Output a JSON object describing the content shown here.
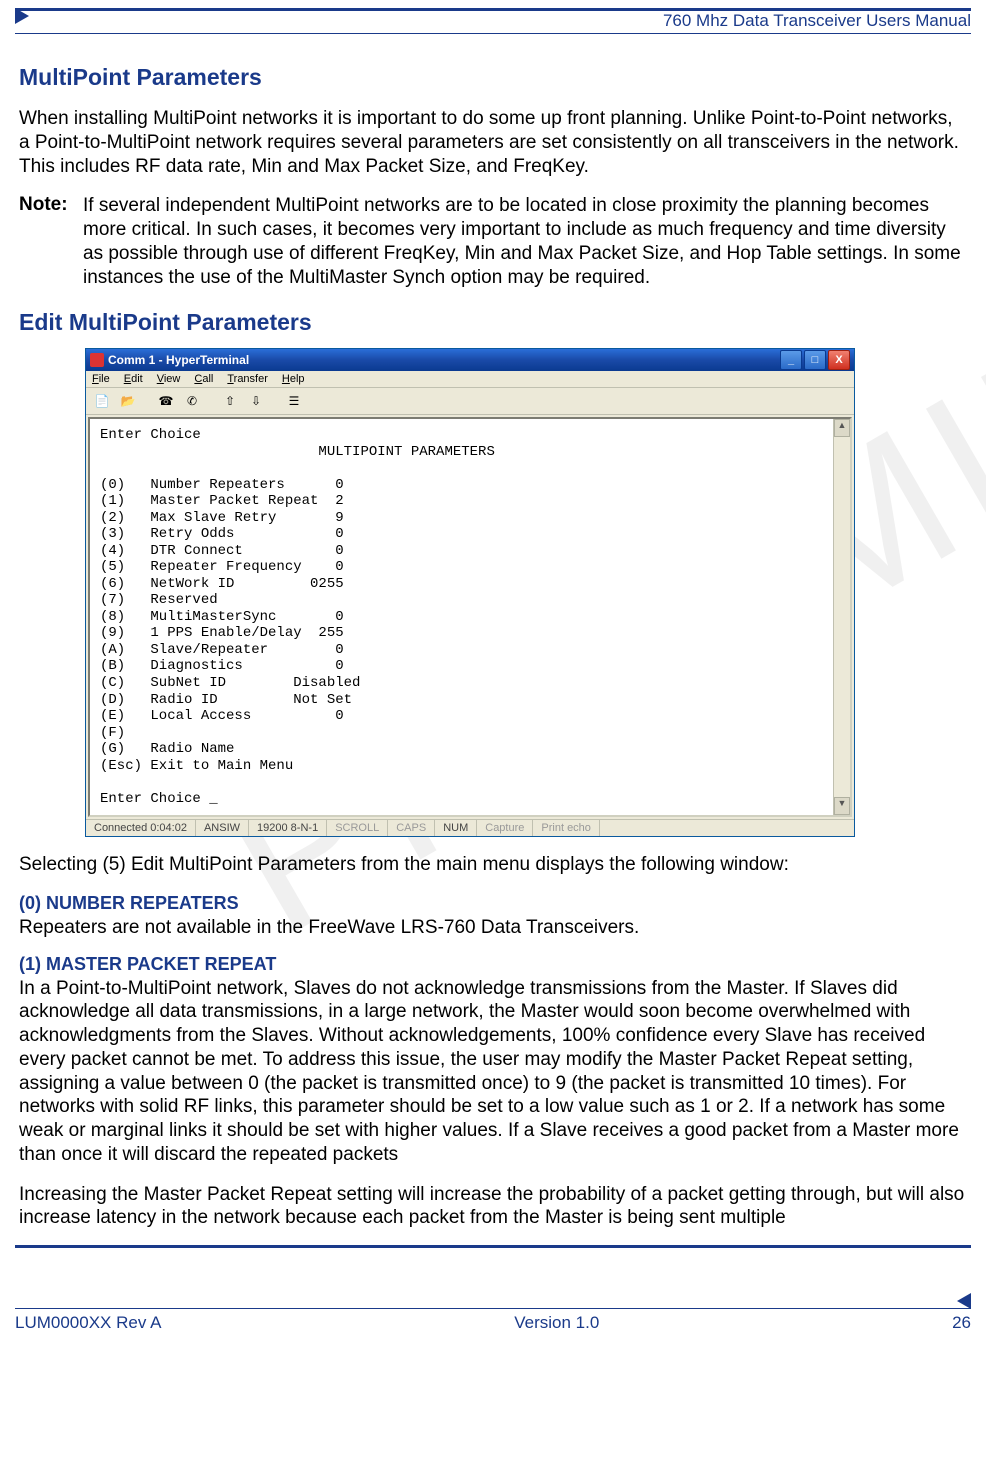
{
  "header": {
    "title": "760 Mhz Data Transceiver Users Manual"
  },
  "watermark": "PRELIMINARY",
  "sections": {
    "h1": "MultiPoint Parameters",
    "p1": "When installing MultiPoint networks it is important to do some up front planning. Unlike Point-to-Point networks, a Point-to-MultiPoint network requires several parameters are set consistently on all transceivers in the network. This includes RF data rate, Min and Max Packet Size, and FreqKey.",
    "note_label": "Note:",
    "note_body": "If several independent MultiPoint networks are to be located in close proximity the planning becomes more critical. In such cases, it becomes very important to include as much frequency and time diversity as possible through use of different FreqKey, Min and Max Packet Size, and Hop Table settings. In some instances the use of the MultiMaster Synch option may be required.",
    "h2": "Edit MultiPoint Parameters",
    "p2": "Selecting (5) Edit MultiPoint Parameters from the main menu displays the following window:",
    "param0_h": " (0) NUMBER REPEATERS",
    "param0_p": "Repeaters are not available in the FreeWave LRS-760 Data Transceivers.",
    "param1_h": "(1) MASTER PACKET REPEAT",
    "param1_p": "In a Point-to-MultiPoint network, Slaves do not acknowledge transmissions from the Master. If Slaves did acknowledge all data transmissions, in a large network, the Master would soon become overwhelmed with acknowledgments from the Slaves.  Without acknowledgements, 100% confidence every Slave has received every packet cannot be met. To address this issue, the user may modify the Master Packet Repeat setting, assigning a value between 0 (the packet is transmitted once) to 9 (the packet is transmitted 10 times). For networks with solid RF links, this parameter should be set to a low value such as 1 or 2. If a network has some weak or marginal links it should be set with higher values. If a Slave receives a good packet from a Master more than once it will discard the repeated packets",
    "param1_p2": "Increasing the Master Packet Repeat setting will increase the probability of a packet getting through, but will also increase latency in the network because each packet from the Master is being sent multiple"
  },
  "hyperterminal": {
    "title": "Comm 1 - HyperTerminal",
    "menu": [
      "File",
      "Edit",
      "View",
      "Call",
      "Transfer",
      "Help"
    ],
    "toolbar_icons": [
      "new-doc-icon",
      "open-icon",
      "sep",
      "call-icon",
      "hangup-icon",
      "sep",
      "send-icon",
      "receive-icon",
      "sep",
      "props-icon"
    ],
    "scroll_up": "▲",
    "scroll_down": "▼",
    "winbtns": {
      "min": "_",
      "max": "□",
      "close": "X"
    },
    "terminal": {
      "prompt1": "Enter Choice",
      "heading": "                          MULTIPOINT PARAMETERS",
      "blank": "",
      "lines": [
        "(0)   Number Repeaters      0",
        "(1)   Master Packet Repeat  2",
        "(2)   Max Slave Retry       9",
        "(3)   Retry Odds            0",
        "(4)   DTR Connect           0",
        "(5)   Repeater Frequency    0",
        "(6)   NetWork ID         0255",
        "(7)   Reserved",
        "(8)   MultiMasterSync       0",
        "(9)   1 PPS Enable/Delay  255",
        "(A)   Slave/Repeater        0",
        "(B)   Diagnostics           0",
        "(C)   SubNet ID        Disabled",
        "(D)   Radio ID         Not Set",
        "(E)   Local Access          0",
        "(F)",
        "(G)   Radio Name",
        "(Esc) Exit to Main Menu"
      ],
      "prompt2": "Enter Choice _"
    },
    "status": {
      "connected": "Connected 0:04:02",
      "emu": "ANSIW",
      "line": "19200 8-N-1",
      "scroll": "SCROLL",
      "caps": "CAPS",
      "num": "NUM",
      "capture": "Capture",
      "printecho": "Print echo"
    }
  },
  "footer": {
    "left": "LUM0000XX Rev A",
    "center": "Version 1.0",
    "right": "26"
  }
}
